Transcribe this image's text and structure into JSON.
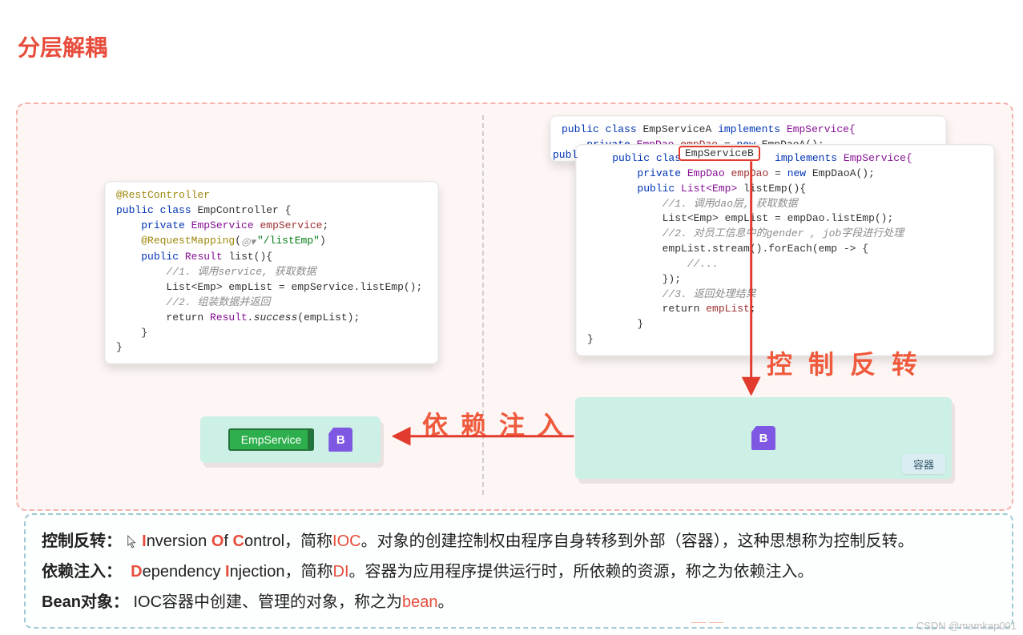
{
  "title": "分层解耦",
  "code_controller": {
    "l1": "@RestController",
    "l2_kw": "public class",
    "l2_name": "EmpController {",
    "l3_kw": "private",
    "l3_type": "EmpService",
    "l3_field": "empService",
    "l3_end": ";",
    "l4_ann": "@RequestMapping",
    "l4_open": "(",
    "l4_icon": "◎▾",
    "l4_str": "\"/listEmp\"",
    "l4_close": ")",
    "l5_kw": "public",
    "l5_type": "Result",
    "l5_name": "list(){",
    "l6_cmt": "//1. 调用service, 获取数据",
    "l7": "List<Emp> empList = empService.listEmp();",
    "l8_cmt": "//2. 组装数据并返回",
    "l9_a": "return ",
    "l9_b": "Result",
    "l9_c": ".success",
    "l9_d": "(empList);",
    "l10": "}",
    "l11": "}"
  },
  "code_service_a": {
    "l1_kw": "public class",
    "l1_name": "EmpServiceA",
    "l1_impl": "implements",
    "l1_if": "EmpService{",
    "l2_kw": "private",
    "l2_type": "EmpDao",
    "l2_field": "empDao",
    "l2_eq": " = ",
    "l2_new": "new",
    "l2_ctor": " EmpDaoA();"
  },
  "code_service_b": {
    "pub": "publ",
    "l1_kw": "public class",
    "l1_hl": "EmpServiceB",
    "l1_impl": "implements",
    "l1_if": "EmpService{",
    "l2_kw": "private",
    "l2_type": "EmpDao",
    "l2_field": "empDao",
    "l2_eq": " = ",
    "l2_new": "new",
    "l2_ctor": " EmpDaoA();",
    "l3_kw": "public",
    "l3_type": "List<Emp>",
    "l3_name": "listEmp(){",
    "l4_cmt": "//1. 调用dao层, 获取数据",
    "l5": "List<Emp> empList = empDao.listEmp();",
    "l6_cmt": "//2. 对员工信息中的gender , job字段进行处理",
    "l7": "empList.stream().forEach(emp -> {",
    "l8_cmt": "//...",
    "l9": "});",
    "l10_cmt": "//3. 返回处理结果",
    "l11_a": "return ",
    "l11_b": "empList",
    "l11_c": ";",
    "l12": "}",
    "l13": "}"
  },
  "labels": {
    "ioc_hand": "控 制 反 转",
    "di_hand": "依 赖 注 入",
    "emp_service_chip": "EmpService",
    "badge": "B",
    "container": "容器"
  },
  "defs": {
    "row1_key": "控制反转：",
    "row1_i": "I",
    "row1_a": "nversion ",
    "row1_o": "O",
    "row1_b": "f ",
    "row1_c": "C",
    "row1_rest": "ontrol，简称",
    "row1_abbr": "IOC",
    "row1_tail": "。对象的创建控制权由程序自身转移到外部（容器），这种思想称为控制反转。",
    "row2_key": "依赖注入：",
    "row2_d": "D",
    "row2_a": "ependency ",
    "row2_i": "I",
    "row2_rest": "njection，简称",
    "row2_abbr": "DI",
    "row2_tail": "。容器为应用程序提供运行时，所依赖的资源，称之为依赖注入。",
    "row3_key": "Bean对象：",
    "row3_a": "IOC容器中创建、管理的对象，称之为",
    "row3_term": "bean",
    "row3_tail": "。"
  },
  "watermark_left": "——",
  "watermark": "CSDN @mamkap001"
}
